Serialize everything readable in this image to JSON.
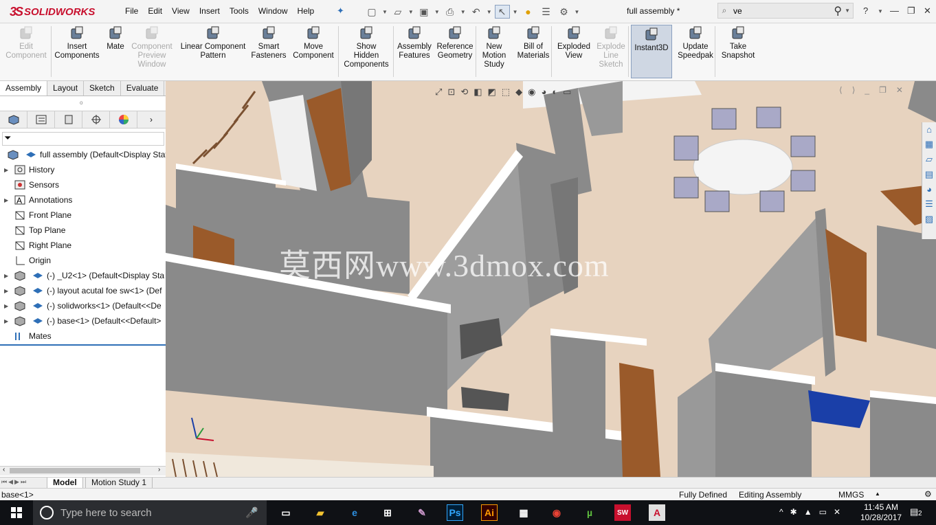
{
  "app": {
    "logo_text": "SOLIDWORKS",
    "logo_prefix": "3S",
    "doc_title": "full assembly *"
  },
  "menu": [
    "File",
    "Edit",
    "View",
    "Insert",
    "Tools",
    "Window",
    "Help"
  ],
  "search": {
    "value": "ve"
  },
  "ribbon": [
    {
      "label": "Edit\nComponent",
      "enabled": false
    },
    {
      "label": "Insert\nComponents",
      "enabled": true
    },
    {
      "label": "Mate",
      "enabled": true
    },
    {
      "label": "Component\nPreview\nWindow",
      "enabled": false
    },
    {
      "label": "Linear Component\nPattern",
      "enabled": true
    },
    {
      "label": "Smart\nFasteners",
      "enabled": true
    },
    {
      "label": "Move\nComponent",
      "enabled": true
    },
    {
      "label": "Show\nHidden\nComponents",
      "enabled": true
    },
    {
      "label": "Assembly\nFeatures",
      "enabled": true
    },
    {
      "label": "Reference\nGeometry",
      "enabled": true
    },
    {
      "label": "New\nMotion\nStudy",
      "enabled": true
    },
    {
      "label": "Bill of\nMaterials",
      "enabled": true
    },
    {
      "label": "Exploded\nView",
      "enabled": true
    },
    {
      "label": "Explode\nLine\nSketch",
      "enabled": false
    },
    {
      "label": "Instant3D",
      "enabled": true,
      "active": true
    },
    {
      "label": "Update\nSpeedpak",
      "enabled": true
    },
    {
      "label": "Take\nSnapshot",
      "enabled": true
    }
  ],
  "command_tabs": [
    "Assembly",
    "Layout",
    "Sketch",
    "Evaluate"
  ],
  "tree": [
    {
      "label": "full assembly  (Default<Display State",
      "expand": false,
      "icon": "assembly"
    },
    {
      "label": "History",
      "expand": true,
      "icon": "history"
    },
    {
      "label": "Sensors",
      "expand": false,
      "icon": "sensor"
    },
    {
      "label": "Annotations",
      "expand": true,
      "icon": "annotation"
    },
    {
      "label": "Front Plane",
      "expand": false,
      "icon": "plane"
    },
    {
      "label": "Top Plane",
      "expand": false,
      "icon": "plane"
    },
    {
      "label": "Right Plane",
      "expand": false,
      "icon": "plane"
    },
    {
      "label": "Origin",
      "expand": false,
      "icon": "origin"
    },
    {
      "label": "(-) _U2<1> (Default<Display Sta",
      "expand": true,
      "icon": "subassembly"
    },
    {
      "label": "(-) layout acutal foe sw<1> (Def",
      "expand": true,
      "icon": "subassembly"
    },
    {
      "label": "(-) solidworks<1> (Default<<De",
      "expand": true,
      "icon": "subassembly"
    },
    {
      "label": "(-) base<1> (Default<<Default>",
      "expand": true,
      "icon": "subassembly"
    },
    {
      "label": "Mates",
      "expand": false,
      "icon": "mates"
    }
  ],
  "watermark": "莫西网www.3dmox.com",
  "bottom_tabs": [
    "Model",
    "Motion Study 1"
  ],
  "status": {
    "left": "base<1>",
    "defined": "Fully Defined",
    "mode": "Editing Assembly",
    "units": "MMGS"
  },
  "taskbar": {
    "search_placeholder": "Type here to search",
    "time": "11:45 AM",
    "date": "10/28/2017",
    "notif": "2"
  },
  "colors": {
    "accent": "#2e6fb7",
    "floor": "#e7d3bf",
    "wall": "#8a8a8a",
    "door": "#9a5a2a",
    "bed": "#1a3fa8",
    "brand": "#c8102e"
  }
}
